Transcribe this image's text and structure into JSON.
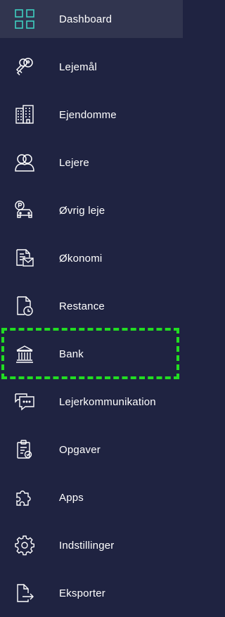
{
  "colors": {
    "background": "#1f2341",
    "active_background": "#31354f",
    "active_icon": "#3ecfc0",
    "icon": "#ffffff",
    "highlight": "#22dd22"
  },
  "sidebar": {
    "items": [
      {
        "label": "Dashboard",
        "icon": "dashboard-grid-icon",
        "active": true
      },
      {
        "label": "Lejemål",
        "icon": "keys-icon"
      },
      {
        "label": "Ejendomme",
        "icon": "building-icon"
      },
      {
        "label": "Lejere",
        "icon": "users-icon"
      },
      {
        "label": "Øvrig leje",
        "icon": "parking-car-icon"
      },
      {
        "label": "Økonomi",
        "icon": "invoice-icon"
      },
      {
        "label": "Restance",
        "icon": "document-clock-icon"
      },
      {
        "label": "Bank",
        "icon": "bank-icon",
        "highlighted": true
      },
      {
        "label": "Lejerkommunikation",
        "icon": "chat-icon"
      },
      {
        "label": "Opgaver",
        "icon": "clipboard-check-icon"
      },
      {
        "label": "Apps",
        "icon": "puzzle-icon"
      },
      {
        "label": "Indstillinger",
        "icon": "gear-icon"
      },
      {
        "label": "Eksporter",
        "icon": "export-icon"
      }
    ]
  }
}
